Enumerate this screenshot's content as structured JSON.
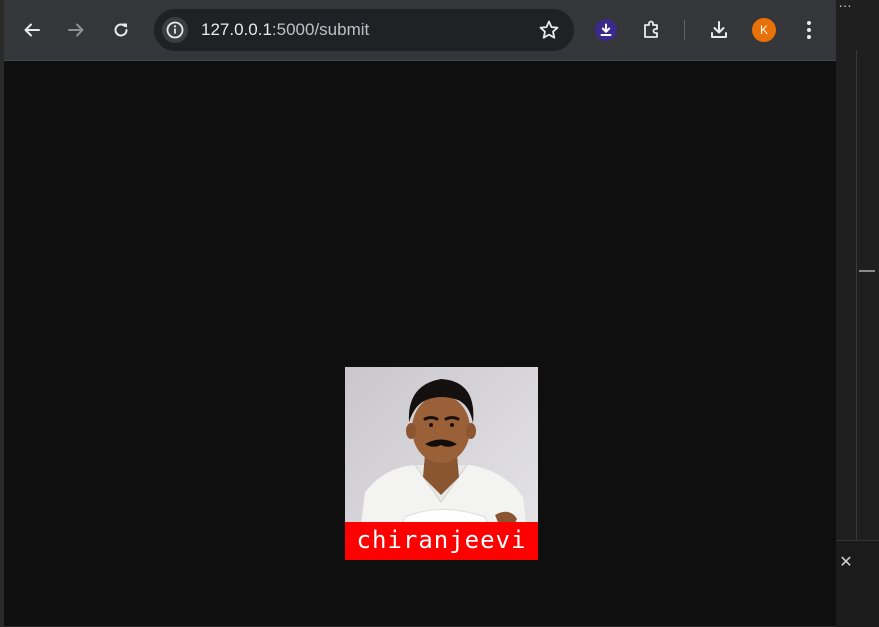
{
  "browser": {
    "url_host": "127.0.0.1",
    "url_path": ":5000/submit",
    "profile_initial": "K",
    "colors": {
      "toolbar": "#35363a",
      "omnibox": "#202124",
      "page_bg": "#0f0f0f",
      "avatar": "#e8710a",
      "extension": "#3b2a8c"
    },
    "icons": [
      "back-icon",
      "forward-icon",
      "reload-icon",
      "info-icon",
      "star-icon",
      "download-extension-icon",
      "extensions-puzzle-icon",
      "downloads-icon",
      "kebab-menu-icon"
    ]
  },
  "page": {
    "image_caption": "chiranjeevi",
    "caption_color": "#ff0000"
  },
  "background_app": {
    "close_glyph": "✕"
  }
}
